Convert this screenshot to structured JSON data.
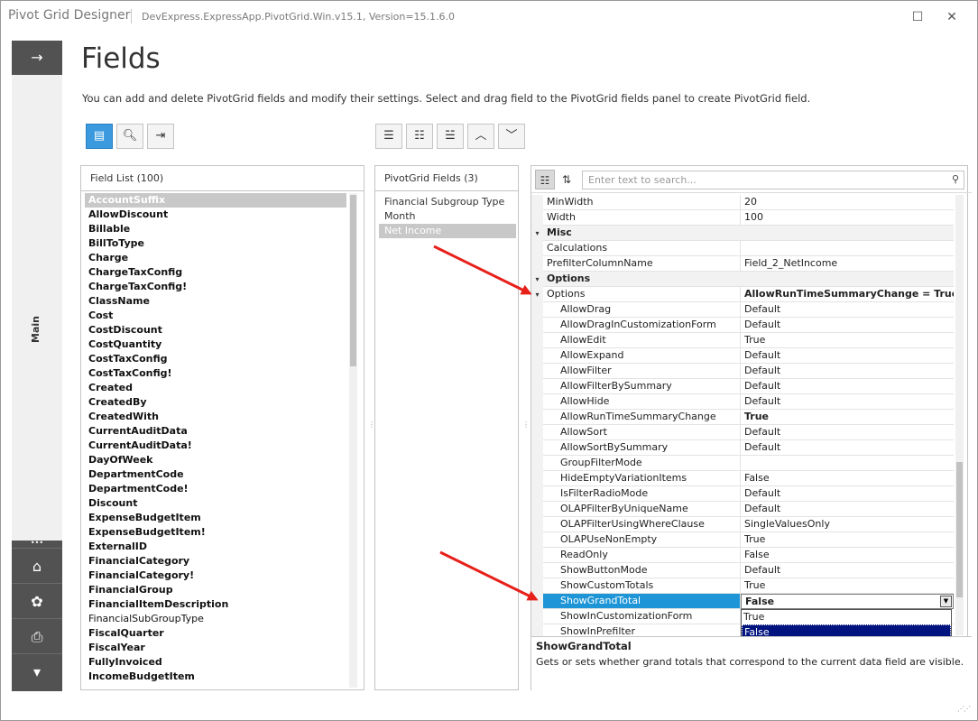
{
  "window": {
    "title": "Pivot Grid Designer",
    "subtitle": "DevExpress.ExpressApp.PivotGrid.Win.v15.1, Version=15.1.6.0",
    "maximize_icon": "maximize-icon",
    "close_icon": "close-icon"
  },
  "sidenav": {
    "main_label": "Main",
    "dots": "•••",
    "buttons": [
      "home-icon",
      "palette-icon",
      "printer-icon",
      "chevron-down-icon"
    ]
  },
  "page": {
    "title": "Fields",
    "description": "You can add and delete PivotGrid fields and modify their settings. Select and drag field to the PivotGrid fields panel to create PivotGrid field."
  },
  "left_toolbar": [
    "list-view-icon",
    "search-icon",
    "export-icon"
  ],
  "mid_toolbar": [
    "add-field-icon",
    "insert-field-icon",
    "remove-field-icon",
    "move-up-icon",
    "move-down-icon"
  ],
  "field_list": {
    "header": "Field List (100)",
    "items": [
      {
        "label": "AccountSuffix",
        "selected": true
      },
      {
        "label": "AllowDiscount"
      },
      {
        "label": "Billable"
      },
      {
        "label": "BillToType"
      },
      {
        "label": "Charge"
      },
      {
        "label": "ChargeTaxConfig"
      },
      {
        "label": "ChargeTaxConfig!"
      },
      {
        "label": "ClassName"
      },
      {
        "label": "Cost"
      },
      {
        "label": "CostDiscount"
      },
      {
        "label": "CostQuantity"
      },
      {
        "label": "CostTaxConfig"
      },
      {
        "label": "CostTaxConfig!"
      },
      {
        "label": "Created"
      },
      {
        "label": "CreatedBy"
      },
      {
        "label": "CreatedWith"
      },
      {
        "label": "CurrentAuditData"
      },
      {
        "label": "CurrentAuditData!"
      },
      {
        "label": "DayOfWeek"
      },
      {
        "label": "DepartmentCode"
      },
      {
        "label": "DepartmentCode!"
      },
      {
        "label": "Discount"
      },
      {
        "label": "ExpenseBudgetItem"
      },
      {
        "label": "ExpenseBudgetItem!"
      },
      {
        "label": "ExternalID"
      },
      {
        "label": "FinancialCategory"
      },
      {
        "label": "FinancialCategory!"
      },
      {
        "label": "FinancialGroup"
      },
      {
        "label": "FinancialItemDescription"
      },
      {
        "label": "FinancialSubGroupType",
        "plain": true
      },
      {
        "label": "FiscalQuarter"
      },
      {
        "label": "FiscalYear"
      },
      {
        "label": "FullyInvoiced"
      },
      {
        "label": "IncomeBudgetItem"
      }
    ]
  },
  "pivot_fields": {
    "header": "PivotGrid Fields (3)",
    "items": [
      {
        "label": "Financial Subgroup Type"
      },
      {
        "label": "Month"
      },
      {
        "label": "Net Income",
        "selected": true
      }
    ]
  },
  "property_grid": {
    "search_placeholder": "Enter text to search...",
    "rows": [
      {
        "name": "MinWidth",
        "value": "20",
        "type": "prop"
      },
      {
        "name": "Width",
        "value": "100",
        "type": "prop"
      },
      {
        "name": "Misc",
        "type": "cat"
      },
      {
        "name": "Calculations",
        "value": "",
        "type": "prop"
      },
      {
        "name": "PrefilterColumnName",
        "value": "Field_2_NetIncome",
        "type": "prop"
      },
      {
        "name": "Options",
        "type": "cat"
      },
      {
        "name": "Options",
        "value": "AllowRunTimeSummaryChange = True, S",
        "type": "expander",
        "bold": true
      },
      {
        "name": "AllowDrag",
        "value": "Default",
        "type": "sub"
      },
      {
        "name": "AllowDragInCustomizationForm",
        "value": "Default",
        "type": "sub"
      },
      {
        "name": "AllowEdit",
        "value": "True",
        "type": "sub"
      },
      {
        "name": "AllowExpand",
        "value": "Default",
        "type": "sub"
      },
      {
        "name": "AllowFilter",
        "value": "Default",
        "type": "sub"
      },
      {
        "name": "AllowFilterBySummary",
        "value": "Default",
        "type": "sub"
      },
      {
        "name": "AllowHide",
        "value": "Default",
        "type": "sub"
      },
      {
        "name": "AllowRunTimeSummaryChange",
        "value": "True",
        "type": "sub",
        "bold": true
      },
      {
        "name": "AllowSort",
        "value": "Default",
        "type": "sub"
      },
      {
        "name": "AllowSortBySummary",
        "value": "Default",
        "type": "sub"
      },
      {
        "name": "GroupFilterMode",
        "value": "",
        "type": "sub"
      },
      {
        "name": "HideEmptyVariationItems",
        "value": "False",
        "type": "sub"
      },
      {
        "name": "IsFilterRadioMode",
        "value": "Default",
        "type": "sub"
      },
      {
        "name": "OLAPFilterByUniqueName",
        "value": "Default",
        "type": "sub"
      },
      {
        "name": "OLAPFilterUsingWhereClause",
        "value": "SingleValuesOnly",
        "type": "sub"
      },
      {
        "name": "OLAPUseNonEmpty",
        "value": "True",
        "type": "sub"
      },
      {
        "name": "ReadOnly",
        "value": "False",
        "type": "sub"
      },
      {
        "name": "ShowButtonMode",
        "value": "Default",
        "type": "sub"
      },
      {
        "name": "ShowCustomTotals",
        "value": "True",
        "type": "sub"
      },
      {
        "name": "ShowGrandTotal",
        "value": "False",
        "type": "sub",
        "highlight": true
      },
      {
        "name": "ShowInCustomizationForm",
        "value": "",
        "type": "sub"
      },
      {
        "name": "ShowInPrefilter",
        "value": "",
        "type": "sub"
      }
    ],
    "dropdown_options": [
      {
        "label": "True"
      },
      {
        "label": "False",
        "selected": true
      }
    ],
    "description_title": "ShowGrandTotal",
    "description_text": "Gets or sets whether grand totals that correspond to the current data field are visible."
  },
  "colors": {
    "accent": "#1e95d6",
    "nav": "#525252",
    "arrow": "#e8201a"
  }
}
